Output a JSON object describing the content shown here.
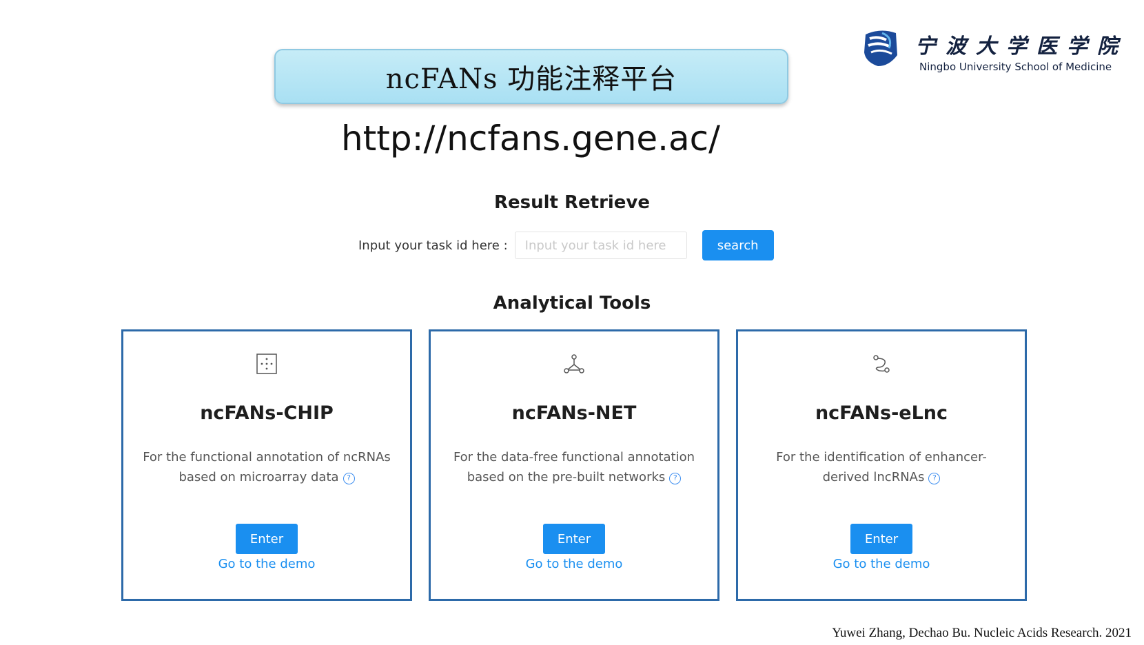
{
  "banner": {
    "title": "ncFANs 功能注释平台",
    "url": "http://ncfans.gene.ac/"
  },
  "logo": {
    "chinese_name": "宁波大学医学院",
    "english_name": "Ningbo University School of Medicine",
    "icon": "university-emblem-icon"
  },
  "retrieve": {
    "title": "Result Retrieve",
    "label": "Input your task id here :",
    "input_value": "",
    "input_placeholder": "Input your task id here",
    "search_label": "search"
  },
  "tools": {
    "title": "Analytical Tools",
    "cards": [
      {
        "icon": "grid-dots-icon",
        "title": "ncFANs-CHIP",
        "desc_line1": "For the functional annotation of ncRNAs",
        "desc_line2": "based on microarray data",
        "enter_label": "Enter",
        "demo_label": "Go to the demo"
      },
      {
        "icon": "network-nodes-icon",
        "title": "ncFANs-NET",
        "desc_line1": "For the data-free functional annotation",
        "desc_line2": "based on the pre-built networks",
        "enter_label": "Enter",
        "demo_label": "Go to the demo"
      },
      {
        "icon": "node-link-icon",
        "title": "ncFANs-eLnc",
        "desc_line1": "For the identification of enhancer-",
        "desc_line2": "derived lncRNAs",
        "enter_label": "Enter",
        "demo_label": "Go to the demo"
      }
    ]
  },
  "citation": "Yuwei Zhang, Dechao Bu. Nucleic Acids Research. 2021",
  "colors": {
    "accent": "#1a8ff0",
    "card_border": "#2d6aa9",
    "banner_bg": "#b5e5f5"
  }
}
